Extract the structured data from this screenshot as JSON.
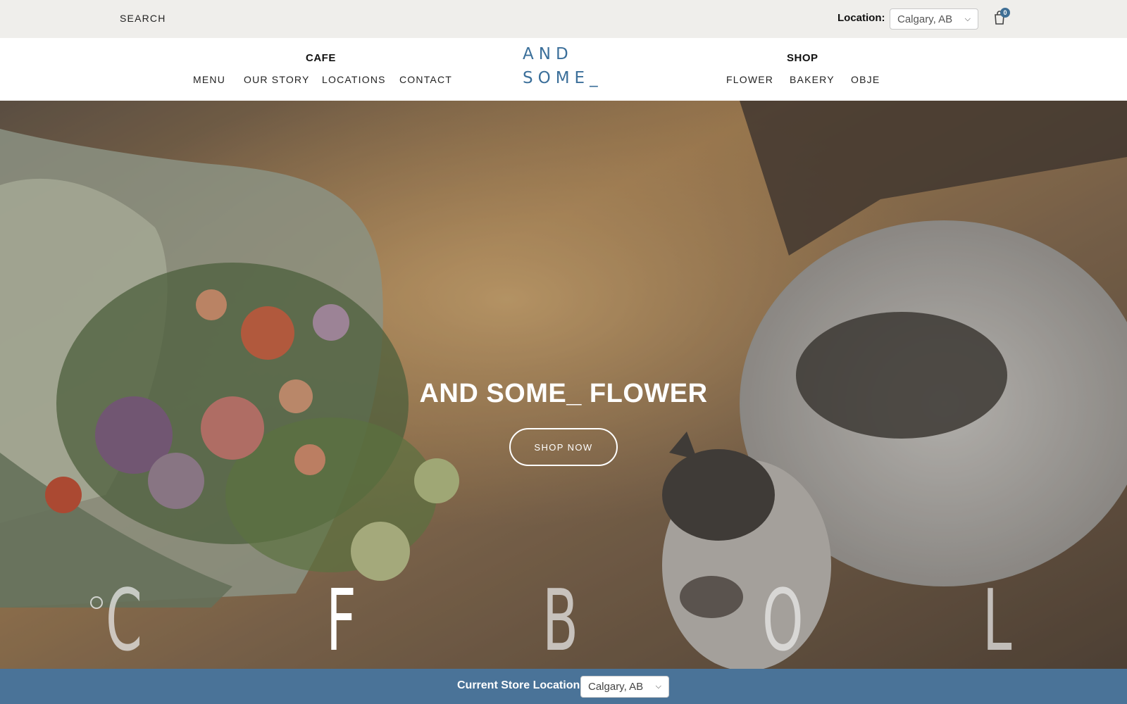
{
  "topbar": {
    "search_label": "SEARCH",
    "location_label": "Location:",
    "location_value": "Calgary, AB",
    "cart_count": "0"
  },
  "header": {
    "logo_line1": "AND",
    "logo_line2": "SOME_",
    "cafe": {
      "title": "CAFE",
      "links": [
        "MENU",
        "OUR STORY",
        "LOCATIONS",
        "CONTACT"
      ]
    },
    "shop": {
      "title": "SHOP",
      "links": [
        "FLOWER",
        "BAKERY",
        "OBJE"
      ]
    }
  },
  "hero": {
    "title": "AND SOME_ FLOWER",
    "button_label": "SHOP NOW",
    "slide_letters": [
      "C",
      "F",
      "B",
      "O",
      "L"
    ],
    "active_letter_index": 1
  },
  "storebar": {
    "label": "Current Store Location:",
    "value": "Calgary, AB"
  },
  "colors": {
    "brand_blue": "#3b6f9a",
    "store_bar": "#4a7398",
    "topbar_bg": "#efeeeb"
  }
}
